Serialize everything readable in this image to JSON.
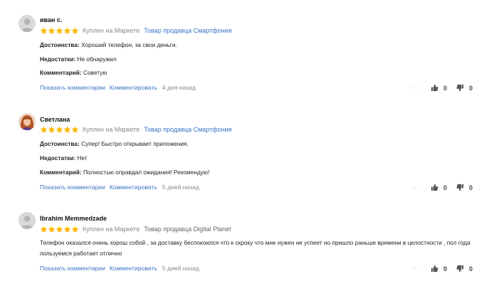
{
  "reviews": [
    {
      "author": "иван с.",
      "avatar": "default-avatar",
      "rating": 5,
      "bought": "Куплен на Маркете",
      "seller": "Товар продавца Смартфония",
      "seller_link": true,
      "fields": [
        {
          "label": "Достоинства:",
          "value": "Хороший телефон, за свои деньги."
        },
        {
          "label": "Недостатки:",
          "value": "Не обнаружил"
        },
        {
          "label": "Комментарий:",
          "value": "Советую"
        }
      ],
      "show_comments": "Показать комментарии",
      "comment": "Комментировать",
      "date": "4 дня назад",
      "more": "···",
      "likes": "0",
      "dislikes": "0"
    },
    {
      "author": "Светлана",
      "avatar": "photo-avatar",
      "rating": 5,
      "bought": "Куплен на Маркете",
      "seller": "Товар продавца Смартфония",
      "seller_link": true,
      "fields": [
        {
          "label": "Достоинства:",
          "value": "Супер! Быстро открывает приложения."
        },
        {
          "label": "Недостатки:",
          "value": "Нет"
        },
        {
          "label": "Комментарий:",
          "value": "Полностью оправдал ожидания! Рекомендую!"
        }
      ],
      "show_comments": "Показать комментарии",
      "comment": "Комментировать",
      "date": "5 дней назад",
      "more": "···",
      "likes": "0",
      "dislikes": "0"
    },
    {
      "author": "Ibrahim Memmedzade",
      "avatar": "default-avatar",
      "rating": 5,
      "bought": "Куплен на Маркете",
      "seller": "Товар продавца Digital Planet",
      "seller_link": false,
      "text": "Телефон оказался очень хорош собой , за доставку беспокоился что к скроку что мне нужен не успеет но пришло раньше времени в целостности , пол года пользуемся работает отлично",
      "show_comments": "Показать комментарии",
      "comment": "Комментировать",
      "date": "5 дней назад",
      "more": "···",
      "likes": "0",
      "dislikes": "0"
    }
  ],
  "colors": {
    "link": "#3a74c7",
    "star": "#ffb800",
    "muted": "#888888"
  }
}
